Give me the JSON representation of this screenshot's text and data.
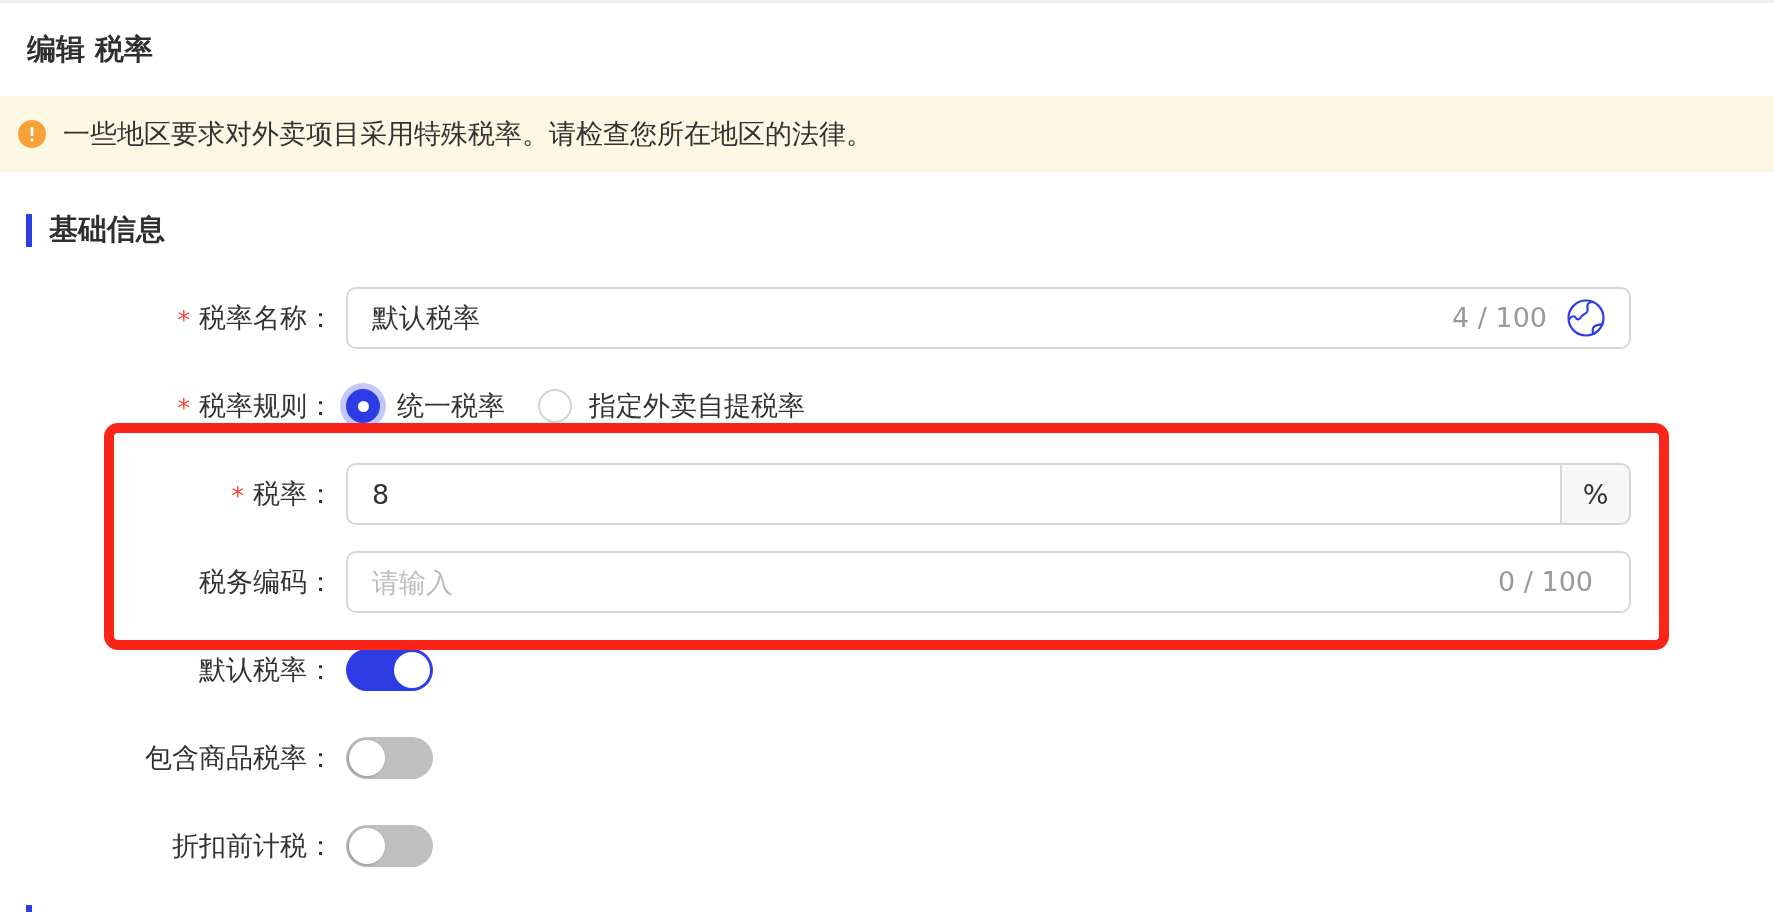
{
  "header": {
    "title": "编辑 税率"
  },
  "notice": {
    "kind": "warning",
    "text": "一些地区要求对外卖项目采用特殊税率。请检查您所在地区的法律。"
  },
  "section": {
    "title": "基础信息"
  },
  "form": {
    "fields": [
      {
        "kind": "text",
        "label": "税率名称：",
        "required_mark": "*",
        "value": "默认税率",
        "counter": "4 / 100",
        "translatable": true,
        "highlighted": false
      },
      {
        "kind": "radio",
        "label": "税率规则：",
        "required_mark": "*",
        "options": [
          {
            "label": "统一税率",
            "selected": true
          },
          {
            "label": "指定外卖自提税率",
            "selected": false
          }
        ],
        "highlighted": false
      },
      {
        "kind": "number",
        "label": "税率：",
        "required_mark": "*",
        "value": "8",
        "suffix": "%",
        "highlighted": true
      },
      {
        "kind": "text",
        "label": "税务编码：",
        "placeholder": "请输入",
        "counter": "0 / 100",
        "translatable": false,
        "highlighted": true
      },
      {
        "kind": "switch",
        "label": "默认税率：",
        "on": true,
        "highlighted": false
      },
      {
        "kind": "switch",
        "label": "包含商品税率：",
        "on": false,
        "highlighted": false
      },
      {
        "kind": "switch",
        "label": "折扣前计税：",
        "on": false,
        "highlighted": false
      }
    ]
  }
}
